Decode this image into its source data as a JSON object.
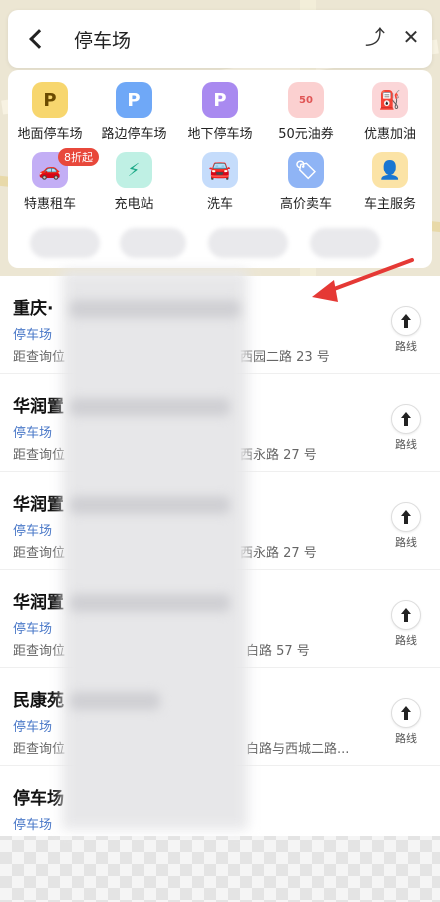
{
  "header": {
    "search_text": "停车场",
    "back_icon": "back-chevron-icon",
    "right_icons": [
      "share-icon",
      "close-icon"
    ]
  },
  "categories": [
    {
      "label": "地面停车场",
      "icon": "parking-P-icon",
      "color": "#f2b21d"
    },
    {
      "label": "路边停车场",
      "icon": "roadside-parking-icon",
      "color": "#4d8ef5"
    },
    {
      "label": "地下停车场",
      "icon": "underground-parking-icon",
      "color": "#8e63e8"
    },
    {
      "label": "50元油券",
      "icon": "fuel-coupon-icon",
      "color": "#f06b6b"
    },
    {
      "label": "优惠加油",
      "icon": "fuel-pump-icon",
      "color": "#f04f5a"
    },
    {
      "label": "特惠租车",
      "icon": "rental-car-icon",
      "color": "#a07ae8",
      "badge": "8折起"
    },
    {
      "label": "充电站",
      "icon": "charging-station-icon",
      "color": "#27c3a4"
    },
    {
      "label": "洗车",
      "icon": "car-wash-icon",
      "color": "#3d8cf0"
    },
    {
      "label": "高价卖车",
      "icon": "sell-car-tag-icon",
      "color": "#4c84ee"
    },
    {
      "label": "车主服务",
      "icon": "owner-service-icon",
      "color": "#f2b21d"
    }
  ],
  "results": [
    {
      "name": "重庆·",
      "type": "停车场",
      "dist": "距查询位",
      "addr": "西园二路 23 号",
      "route_label": "路线"
    },
    {
      "name": "华润置",
      "type": "停车场",
      "dist": "距查询位",
      "addr": "西永路 27 号",
      "route_label": "路线"
    },
    {
      "name": "华润置",
      "type": "停车场",
      "dist": "距查询位",
      "addr": "西永路 27 号",
      "route_label": "路线"
    },
    {
      "name": "华润置",
      "type": "停车场",
      "dist": "距查询位",
      "addr": "白路 57 号",
      "route_label": "路线"
    },
    {
      "name": "民康苑",
      "type": "停车场",
      "dist": "距查询位",
      "addr": "白路与西城二路...",
      "route_label": "路线"
    },
    {
      "name": "停车场",
      "type": "停车场",
      "dist": "",
      "addr": "",
      "route_label": ""
    }
  ],
  "colors": {
    "accent_blue": "#4a78c8",
    "annotation_red": "#e53935"
  }
}
